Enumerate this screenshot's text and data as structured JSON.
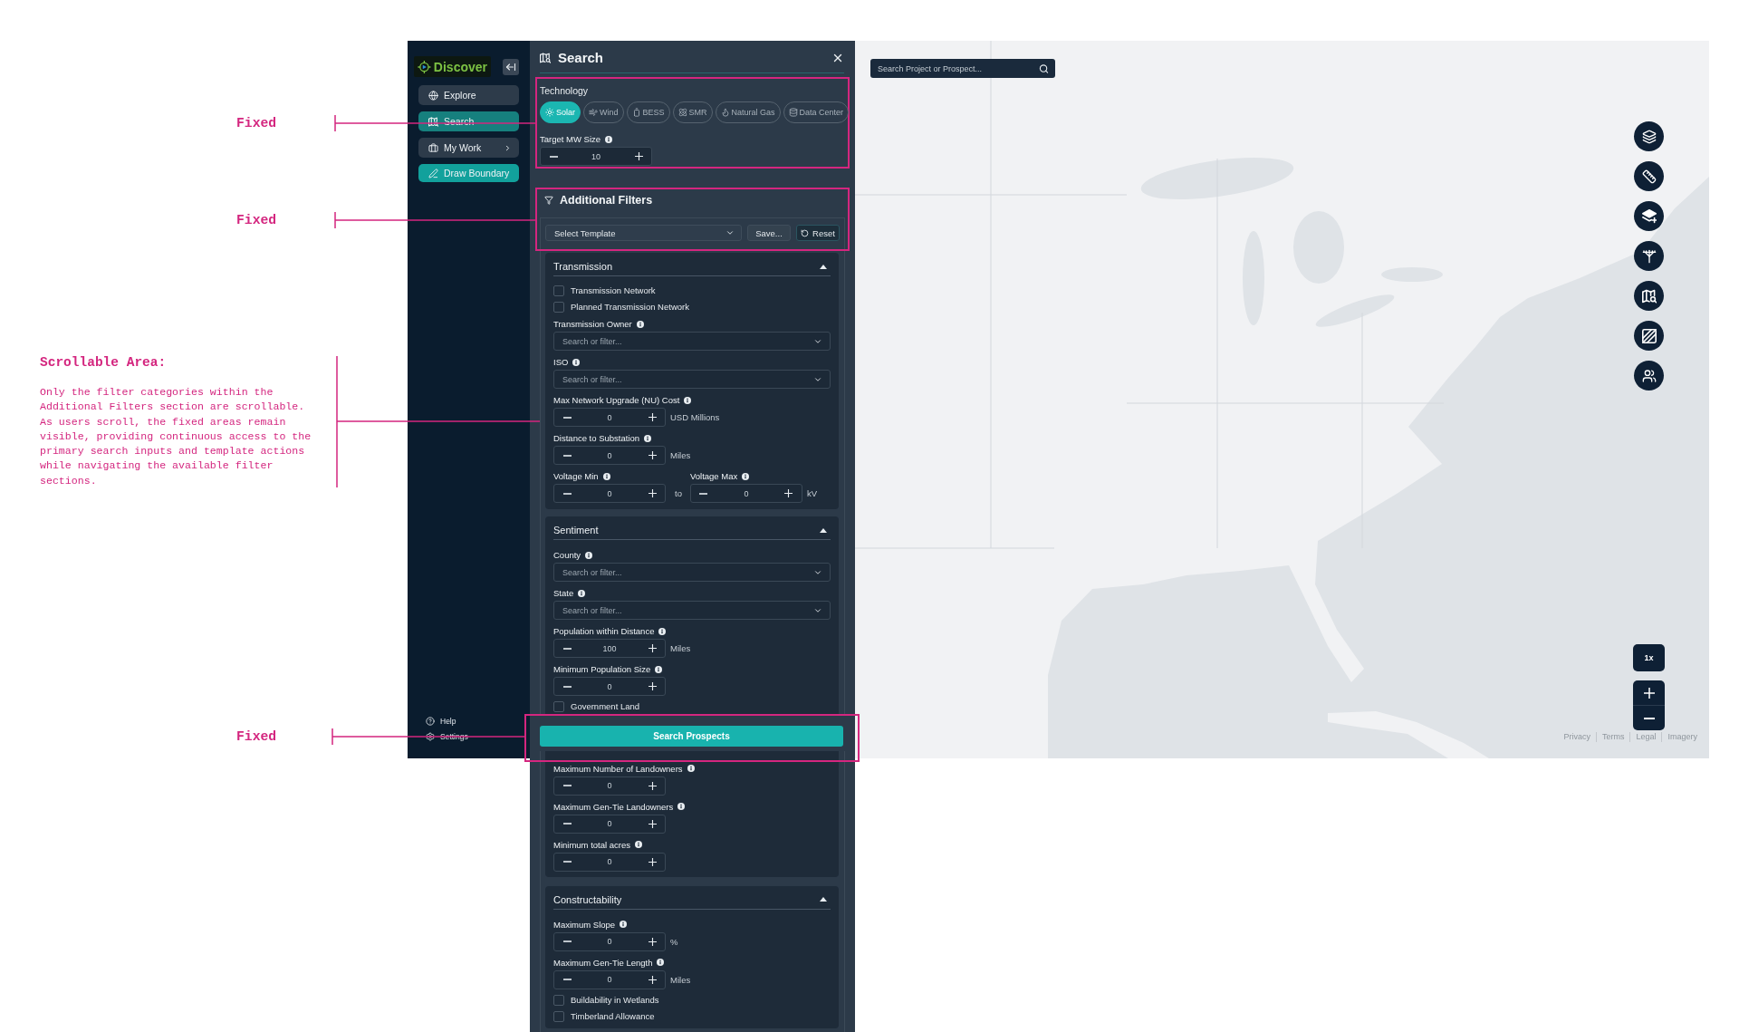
{
  "annotations": [
    {
      "kind": "fixed",
      "text": "Fixed"
    },
    {
      "kind": "fixed",
      "text": "Fixed"
    },
    {
      "kind": "note",
      "title": "Scrollable Area:",
      "text": "Only the filter categories within the Additional Filters section are scrollable. As users scroll, the fixed areas remain visible, providing continuous access to the primary search inputs and template actions while navigating the available filter sections."
    },
    {
      "kind": "fixed",
      "text": "Fixed"
    }
  ],
  "sidebar": {
    "logo": "Discover",
    "nav": [
      {
        "kind": "link",
        "label": "Explore",
        "selected": false
      },
      {
        "kind": "link",
        "label": "Search",
        "selected": true
      },
      {
        "kind": "menu",
        "label": "My Work",
        "selected": false
      },
      {
        "kind": "action",
        "label": "Draw Boundary",
        "selected": false
      }
    ],
    "footer": [
      "Help",
      "Settings"
    ]
  },
  "search_panel": {
    "title": "Search",
    "technology": {
      "label": "Technology",
      "options": [
        {
          "label": "Solar",
          "selected": true
        },
        {
          "label": "Wind",
          "selected": false
        },
        {
          "label": "BESS",
          "selected": false
        },
        {
          "label": "SMR",
          "selected": false
        },
        {
          "label": "Natural Gas",
          "selected": false
        },
        {
          "label": "Data Center",
          "selected": false
        }
      ],
      "target_size": {
        "label": "Target MW Size",
        "value": "10"
      }
    },
    "additional_filters": {
      "title": "Additional Filters",
      "template": {
        "placeholder": "Select Template"
      },
      "buttons": [
        {
          "kind": "save",
          "label": "Save..."
        },
        {
          "kind": "reset",
          "label": "Reset"
        }
      ]
    },
    "sections": [
      {
        "title": "Transmission",
        "expanded": true,
        "fields": [
          {
            "kind": "checkbox",
            "label": "Transmission Network",
            "checked": false
          },
          {
            "kind": "checkbox",
            "label": "Planned Transmission Network",
            "checked": false
          },
          {
            "kind": "dropdown",
            "label": "Transmission Owner",
            "placeholder": "Search or filter..."
          },
          {
            "kind": "dropdown",
            "label": "ISO",
            "placeholder": "Search or filter..."
          },
          {
            "kind": "stepper",
            "label": "Max Network Upgrade (NU) Cost",
            "value": "0",
            "unit": "USD Millions"
          },
          {
            "kind": "stepper",
            "label": "Distance to Substation",
            "value": "0",
            "unit": "Miles"
          },
          {
            "kind": "range",
            "min": {
              "label": "Voltage Min",
              "value": "0"
            },
            "joiner": "to",
            "max": {
              "label": "Voltage Max",
              "value": "0"
            },
            "unit": "kV"
          }
        ]
      },
      {
        "title": "Sentiment",
        "expanded": true,
        "fields": [
          {
            "kind": "dropdown",
            "label": "County",
            "placeholder": "Search or filter..."
          },
          {
            "kind": "dropdown",
            "label": "State",
            "placeholder": "Search or filter..."
          },
          {
            "kind": "stepper",
            "label": "Population within Distance",
            "value": "100",
            "unit": "Miles"
          },
          {
            "kind": "stepper",
            "label": "Minimum Population Size",
            "value": "0"
          },
          {
            "kind": "checkbox",
            "label": "Government Land",
            "checked": false
          }
        ]
      }
    ],
    "footer": {
      "button": "Search Prospects"
    },
    "below_footer": [
      {
        "fields": [
          {
            "kind": "stepper",
            "label": "Maximum Number of Landowners",
            "value": "0"
          },
          {
            "kind": "stepper",
            "label": "Maximum Gen-Tie Landowners",
            "value": "0"
          },
          {
            "kind": "stepper",
            "label": "Minimum total acres",
            "value": "0"
          }
        ]
      },
      {
        "title": "Constructability",
        "expanded": true,
        "fields": [
          {
            "kind": "stepper",
            "label": "Maximum Slope",
            "value": "0",
            "unit": "%"
          },
          {
            "kind": "stepper",
            "label": "Maximum Gen-Tie Length",
            "value": "0",
            "unit": "Miles"
          },
          {
            "kind": "checkbox",
            "label": "Buildability in Wetlands",
            "checked": false
          },
          {
            "kind": "checkbox",
            "label": "Timberland Allowance",
            "checked": false
          }
        ]
      }
    ]
  },
  "map": {
    "search": {
      "placeholder": "Search Project or Prospect..."
    },
    "zoom_level": "1x",
    "attribution": [
      "Privacy",
      "Terms",
      "Legal",
      "Imagery"
    ]
  }
}
